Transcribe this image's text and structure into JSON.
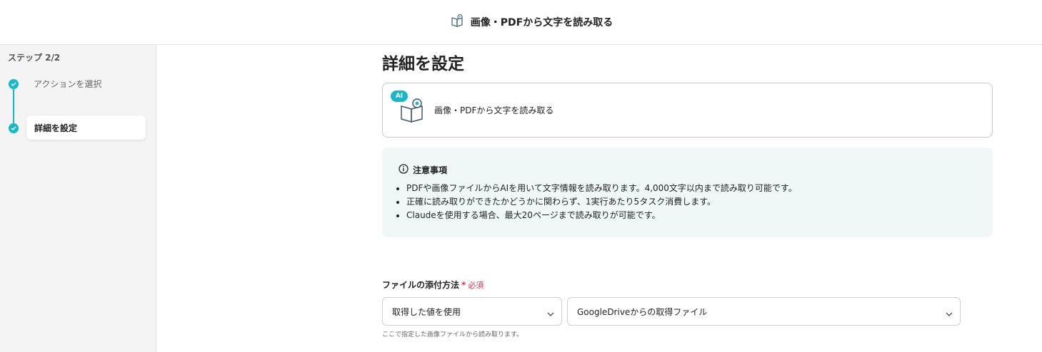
{
  "header": {
    "title": "画像・PDFから文字を読み取る",
    "icon": "book-eye-icon"
  },
  "sidebar": {
    "step_count": "ステップ 2/2",
    "steps": [
      {
        "label": "アクションを選択",
        "status": "done"
      },
      {
        "label": "詳細を設定",
        "status": "active"
      }
    ]
  },
  "main": {
    "title": "詳細を設定",
    "action_card": {
      "badge": "AI",
      "label": "画像・PDFから文字を読み取る"
    },
    "notice": {
      "title": "注意事項",
      "items": [
        "PDFや画像ファイルからAIを用いて文字情報を読み取ります。4,000文字以内まで読み取り可能です。",
        "正確に読み取りができたかどうかに関わらず、1実行あたり5タスク消費します。",
        "Claudeを使用する場合、最大20ページまで読み取りが可能です。"
      ]
    },
    "file_field": {
      "label": "ファイルの添付方法",
      "required_mark": "*",
      "required_text": "必須",
      "method_value": "取得した値を使用",
      "source_value": "GoogleDriveからの取得ファイル",
      "hint": "ここで指定した画像ファイルから読み取ります。"
    }
  },
  "colors": {
    "accent": "#17b8c9",
    "required": "#e0304e",
    "notice_bg": "#eff8f7"
  }
}
